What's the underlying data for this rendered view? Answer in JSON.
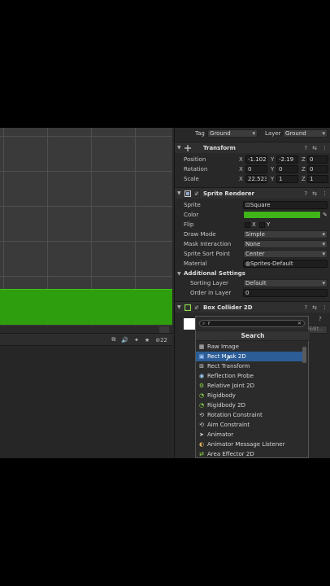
{
  "header": {
    "tag_label": "Tag",
    "tag_value": "Ground",
    "layer_label": "Layer",
    "layer_value": "Ground"
  },
  "scene": {
    "toolbar_count": "22"
  },
  "transform": {
    "title": "Transform",
    "position_label": "Position",
    "position": {
      "x": "-1.1022",
      "y": "-2.19",
      "z": "0"
    },
    "rotation_label": "Rotation",
    "rotation": {
      "x": "0",
      "y": "0",
      "z": "0"
    },
    "scale_label": "Scale",
    "scale": {
      "x": "22.523",
      "y": "1",
      "z": "1"
    }
  },
  "sprite_renderer": {
    "title": "Sprite Renderer",
    "sprite_label": "Sprite",
    "sprite_value": "Square",
    "color_label": "Color",
    "color_value": "#3fb51a",
    "flip_label": "Flip",
    "flip_x": "X",
    "flip_y": "Y",
    "draw_mode_label": "Draw Mode",
    "draw_mode_value": "Simple",
    "mask_label": "Mask Interaction",
    "mask_value": "None",
    "sort_point_label": "Sprite Sort Point",
    "sort_point_value": "Center",
    "material_label": "Material",
    "material_value": "Sprites-Default",
    "additional_label": "Additional Settings",
    "sorting_layer_label": "Sorting Layer",
    "sorting_layer_value": "Default",
    "order_label": "Order in Layer",
    "order_value": "0"
  },
  "box_collider": {
    "title": "Box Collider 2D",
    "edit_label": "Edit..."
  },
  "popup": {
    "search_value": "r",
    "title": "Search",
    "items": [
      {
        "label": "Raw Image",
        "icon": "raw-image-icon"
      },
      {
        "label": "Rect Mask 2D",
        "icon": "rect-mask-icon",
        "selected": true
      },
      {
        "label": "Rect Transform",
        "icon": "rect-transform-icon"
      },
      {
        "label": "Reflection Probe",
        "icon": "reflection-probe-icon"
      },
      {
        "label": "Relative Joint 2D",
        "icon": "joint-icon"
      },
      {
        "label": "Rigidbody",
        "icon": "rigidbody-icon"
      },
      {
        "label": "Rigidbody 2D",
        "icon": "rigidbody-icon"
      },
      {
        "label": "Rotation Constraint",
        "icon": "constraint-icon"
      },
      {
        "label": "Aim Constraint",
        "icon": "constraint-icon"
      },
      {
        "label": "Animator",
        "icon": "animator-icon"
      },
      {
        "label": "Animator Message Listener",
        "icon": "script-icon"
      },
      {
        "label": "Area Effector 2D",
        "icon": "effector-icon"
      }
    ]
  },
  "colors": {
    "ground_green": "#2f9e0e",
    "selection_blue": "#2c5d97",
    "panel_bg": "#282828"
  }
}
